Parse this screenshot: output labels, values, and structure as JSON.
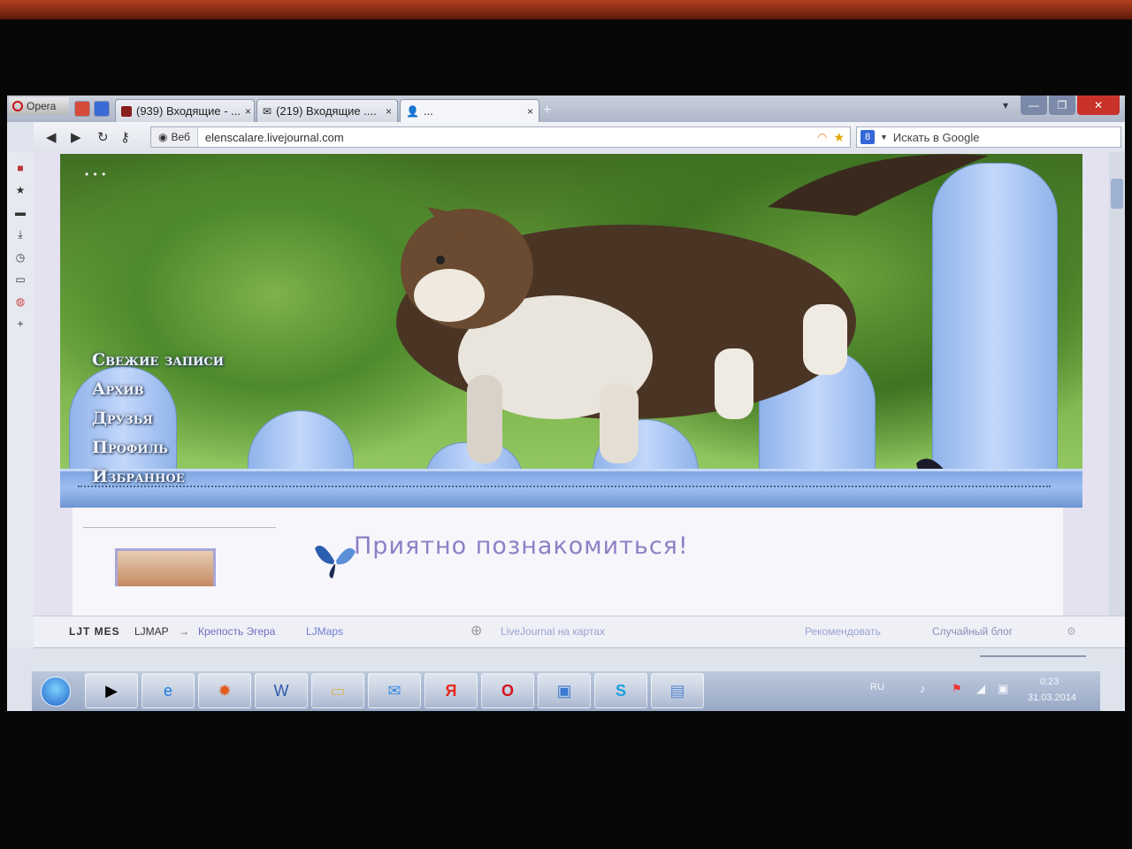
{
  "browser": {
    "menu_label": "Opera",
    "tabs": [
      {
        "title": "(939) Входящие - ...",
        "close": "×"
      },
      {
        "title": "(219) Входящие ....",
        "close": "×"
      },
      {
        "title": "...",
        "close": "×"
      }
    ],
    "window_controls": [
      "▾",
      "—",
      "❐",
      "✕"
    ]
  },
  "address": {
    "site_label": "Веб",
    "url": "elenscalare.livejournal.com",
    "search_engine": "8",
    "search_placeholder": "Искать в Google"
  },
  "journal": {
    "nav_items": [
      "Свежие записи",
      "Архив",
      "Друзья",
      "Профиль",
      "Избранное"
    ],
    "header_dots": "• • •",
    "greeting": "Приятно познакомиться!"
  },
  "lj_toolbar": {
    "brand": "LJT MES",
    "ljmap_label": "LJMAP",
    "arrow": "→",
    "ljmap_link": "Крепость Эгера",
    "ljmaps": "LJMaps",
    "map_link": "LiveJournal на картах",
    "recommend": "Рекомендовать",
    "random_blog": "Случайный блог"
  },
  "taskbar": {
    "lang": "RU",
    "time": "0:23",
    "date": "31.03.2014",
    "apps": [
      "media-player-icon",
      "internet-explorer-icon",
      "paint-icon",
      "word-icon",
      "folder-icon",
      "mail-icon",
      "yandex-icon",
      "opera-icon",
      "picture-viewer-icon",
      "skype-icon",
      "remote-desktop-icon"
    ]
  },
  "colors": {
    "accent": "#8f7fc6",
    "fence": "#9cbef0",
    "opera_red": "#c8121d"
  }
}
